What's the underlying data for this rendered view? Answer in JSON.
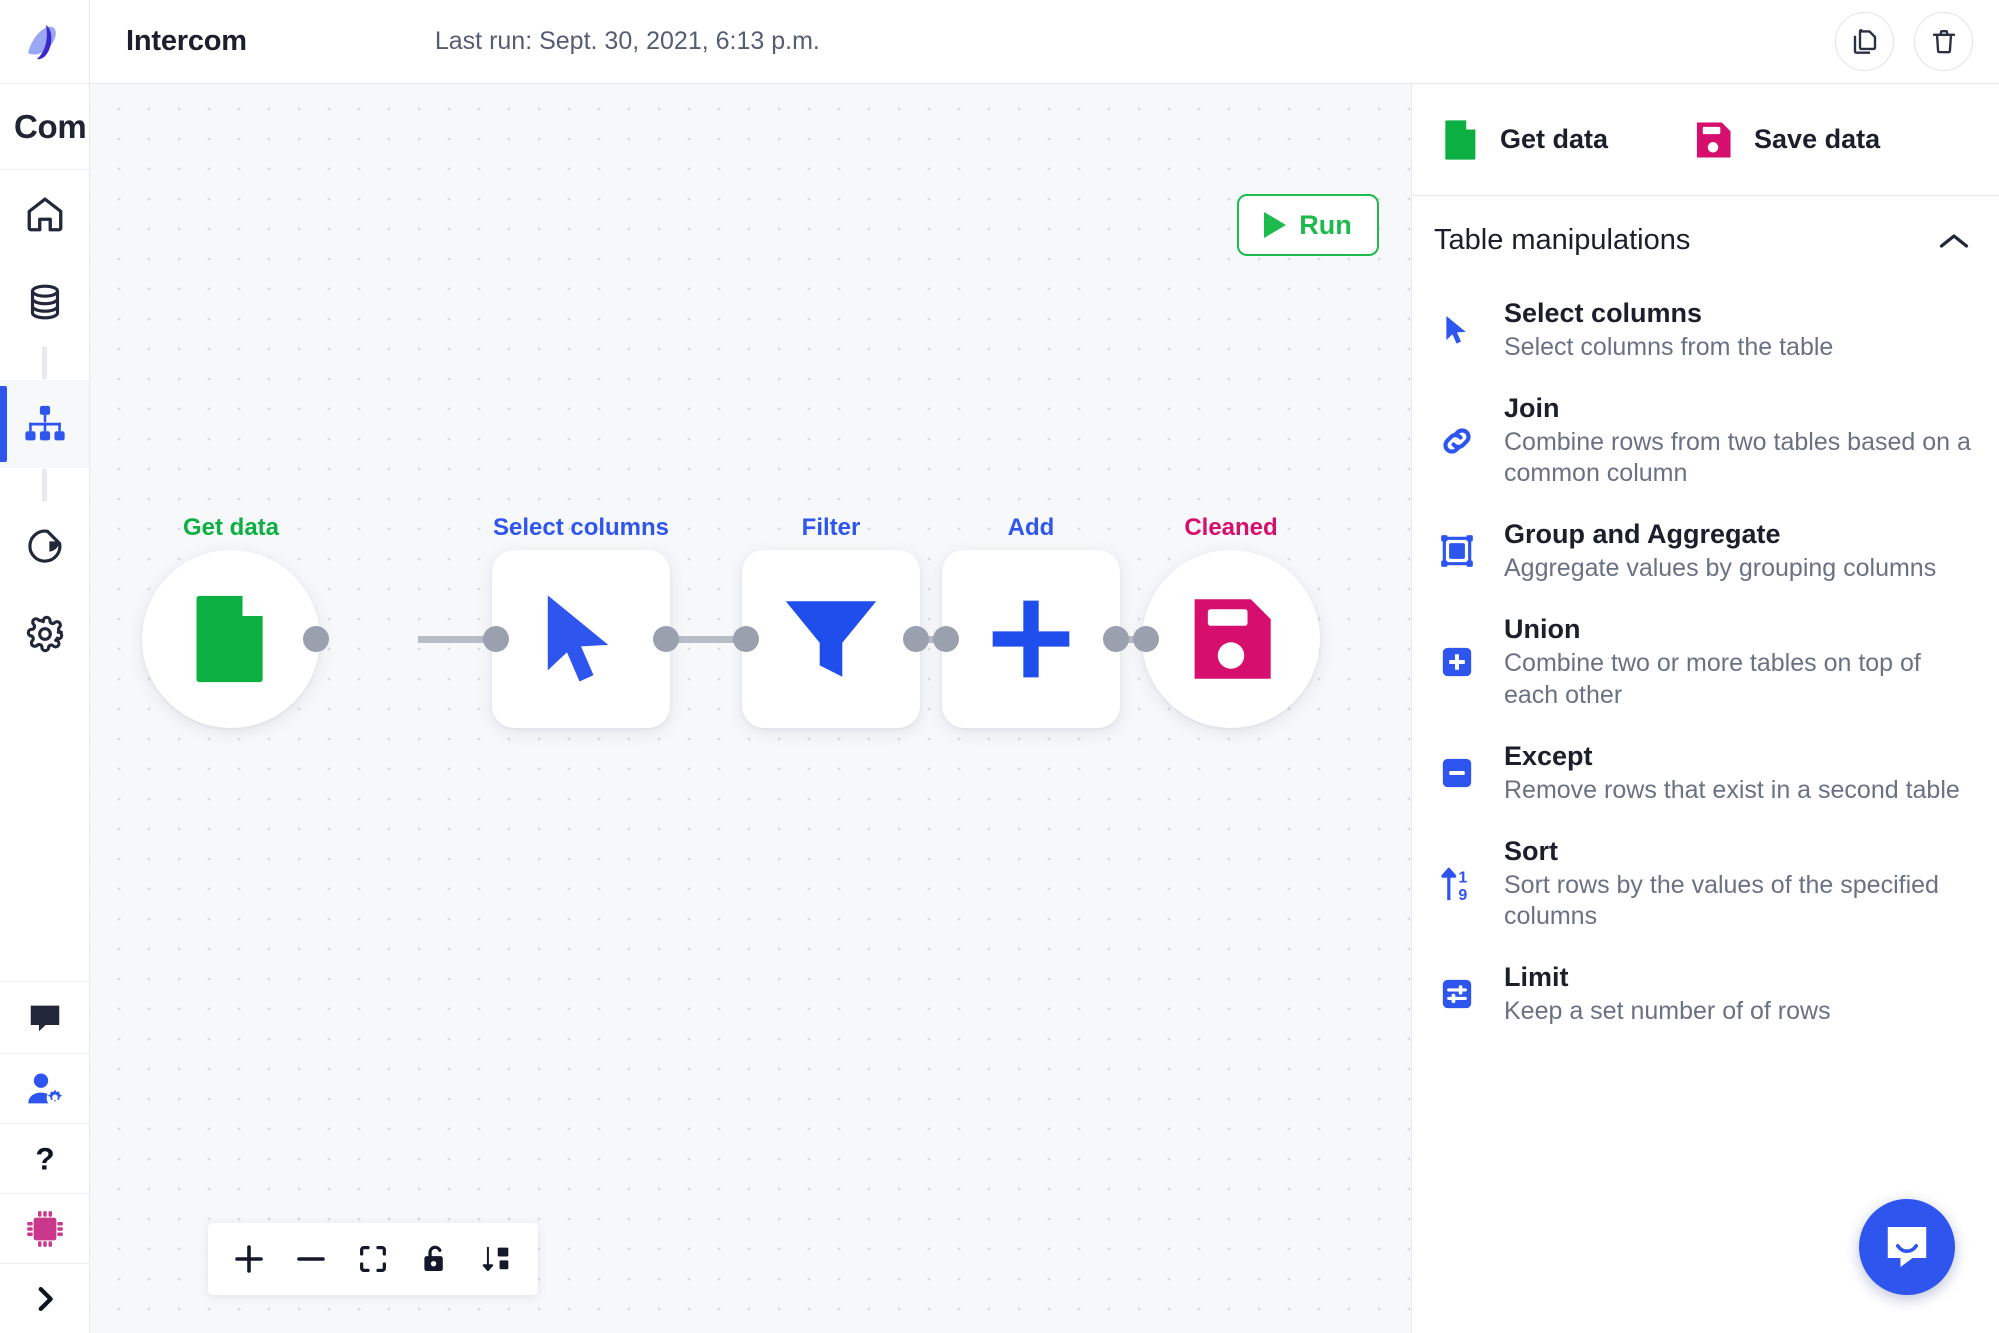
{
  "app": {
    "brand_text": "Com",
    "logo_icon": "app-logo-icon"
  },
  "sidebar": {
    "items": [
      {
        "label": "Home",
        "icon": "home-icon",
        "active": false
      },
      {
        "label": "Data sources",
        "icon": "database-icon",
        "active": false
      },
      {
        "label": "Pipelines",
        "icon": "hierarchy-icon",
        "active": true
      },
      {
        "label": "Dashboards",
        "icon": "pie-chart-icon",
        "active": false
      },
      {
        "label": "Settings",
        "icon": "gear-icon",
        "active": false
      }
    ],
    "bottom_items": [
      {
        "label": "Messages",
        "icon": "chat-bubble-icon"
      },
      {
        "label": "User settings",
        "icon": "user-settings-icon"
      },
      {
        "label": "Help",
        "icon": "question-mark-icon"
      },
      {
        "label": "Integrations",
        "icon": "chip-icon"
      },
      {
        "label": "Expand sidebar",
        "icon": "chevron-right-icon"
      }
    ]
  },
  "topbar": {
    "title": "Intercom",
    "last_run": "Last run: Sept. 30, 2021, 6:13 p.m.",
    "copy_icon": "copy-icon",
    "delete_icon": "trash-icon"
  },
  "canvas": {
    "run_button": "Run",
    "run_icon": "play-icon",
    "toolbar": [
      {
        "name": "zoom-in",
        "icon": "plus-icon"
      },
      {
        "name": "zoom-out",
        "icon": "minus-icon"
      },
      {
        "name": "fit-view",
        "icon": "fit-screen-icon"
      },
      {
        "name": "toggle-lock",
        "icon": "unlock-icon"
      },
      {
        "name": "auto-layout",
        "icon": "sort-layout-icon"
      }
    ],
    "nodes": [
      {
        "label": "Get data",
        "icon": "file-icon",
        "shape": "circle",
        "color": "#0caf41",
        "label_color": "#0caf41"
      },
      {
        "label": "Select columns",
        "icon": "cursor-icon",
        "shape": "square",
        "color": "#2f55ef",
        "label_color": "#2f55ef"
      },
      {
        "label": "Filter",
        "icon": "funnel-icon",
        "shape": "square",
        "color": "#1f4eed",
        "label_color": "#2f55ef"
      },
      {
        "label": "Add",
        "icon": "plus-icon",
        "shape": "square",
        "color": "#1f4eed",
        "label_color": "#2f55ef"
      },
      {
        "label": "Cleaned",
        "icon": "save-disk-icon",
        "shape": "circle",
        "color": "#d60e6e",
        "label_color": "#d60e6e"
      }
    ]
  },
  "right_panel": {
    "sources": [
      {
        "label": "Get data",
        "icon": "file-icon",
        "color": "#0caf41"
      },
      {
        "label": "Save data",
        "icon": "save-disk-icon",
        "color": "#d60e6e"
      }
    ],
    "section_title": "Table manipulations",
    "section_collapse_icon": "chevron-up-icon",
    "items": [
      {
        "title": "Select columns",
        "desc": "Select columns from the table",
        "icon": "cursor-icon"
      },
      {
        "title": "Join",
        "desc": "Combine rows from two tables based on a common column",
        "icon": "link-icon"
      },
      {
        "title": "Group and Aggregate",
        "desc": "Aggregate values by grouping columns",
        "icon": "group-frame-icon"
      },
      {
        "title": "Union",
        "desc": "Combine two or more tables on top of each other",
        "icon": "plus-square-icon"
      },
      {
        "title": "Except",
        "desc": "Remove rows that exist in a second table",
        "icon": "minus-square-icon"
      },
      {
        "title": "Sort",
        "desc": "Sort rows by the values of the specified columns",
        "icon": "sort-numeric-icon"
      },
      {
        "title": "Limit",
        "desc": "Keep a set number of of rows",
        "icon": "sliders-icon"
      }
    ]
  },
  "intercom": {
    "icon": "intercom-chat-icon"
  },
  "colors": {
    "accent_blue": "#2f55ef",
    "green": "#0caf41",
    "pink": "#d60e6e",
    "canvas_bg": "#f7f8fa",
    "text_dark": "#1c1f2b",
    "text_muted": "#6b7184"
  }
}
